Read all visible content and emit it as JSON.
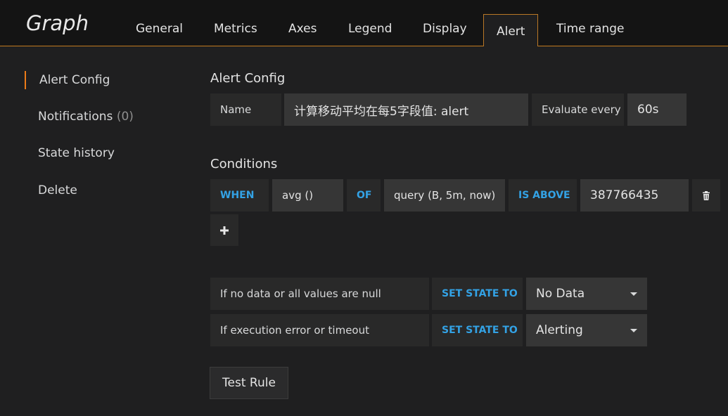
{
  "header": {
    "title": "Graph",
    "tabs": [
      "General",
      "Metrics",
      "Axes",
      "Legend",
      "Display",
      "Alert",
      "Time range"
    ],
    "active_tab": "Alert"
  },
  "sidebar": {
    "items": [
      {
        "label": "Alert Config"
      },
      {
        "label": "Notifications",
        "count": "(0)"
      },
      {
        "label": "State history"
      },
      {
        "label": "Delete"
      }
    ]
  },
  "alert_config": {
    "title": "Alert Config",
    "name_label": "Name",
    "name_value": "计算移动平均在每5字段值: alert",
    "evaluate_label": "Evaluate every",
    "evaluate_value": "60s"
  },
  "conditions": {
    "title": "Conditions",
    "when": "WHEN",
    "reducer": "avg ()",
    "of": "OF",
    "query": "query (B, 5m, now)",
    "evaluator": "IS ABOVE",
    "threshold": "387766435",
    "delete_icon": "trash-icon",
    "add_icon": "plus-icon"
  },
  "state_rules": [
    {
      "label": "If no data or all values are null",
      "set_state": "SET STATE TO",
      "value": "No Data"
    },
    {
      "label": "If execution error or timeout",
      "set_state": "SET STATE TO",
      "value": "Alerting"
    }
  ],
  "test_rule_label": "Test Rule",
  "colors": {
    "accent": "#eb7b18",
    "keyword": "#33a2e5",
    "background": "#1f1f20"
  }
}
